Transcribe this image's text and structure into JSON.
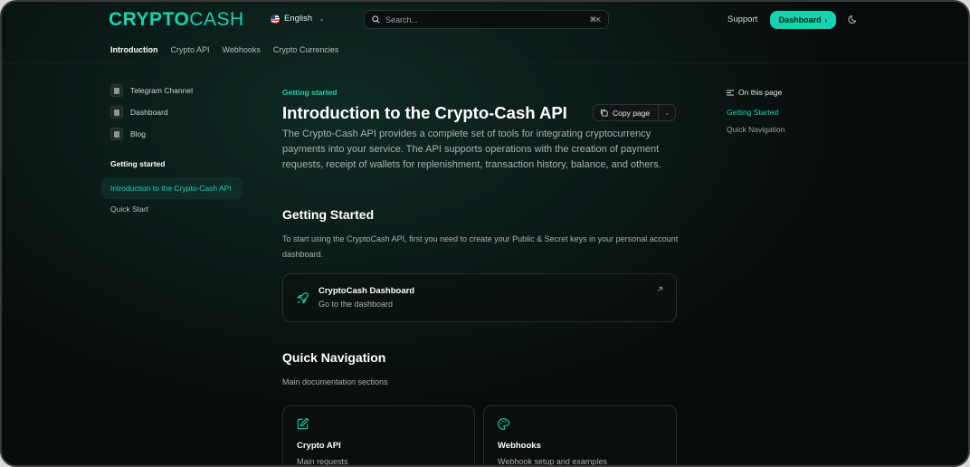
{
  "header": {
    "logo_bold": "CRYPTO",
    "logo_light": "CASH",
    "language": "English",
    "search_placeholder": "Search...",
    "search_shortcut": "⌘K",
    "support": "Support",
    "dashboard_button": "Dashboard",
    "brand_color": "#19d3b0"
  },
  "tabs": [
    {
      "label": "Introduction",
      "active": true
    },
    {
      "label": "Crypto API"
    },
    {
      "label": "Webhooks"
    },
    {
      "label": "Crypto Currencies"
    }
  ],
  "sidebar": {
    "links": [
      {
        "label": "Telegram Channel",
        "icon": "telegram-icon"
      },
      {
        "label": "Dashboard",
        "icon": "dashboard-icon"
      },
      {
        "label": "Blog",
        "icon": "blog-icon"
      }
    ],
    "group_title": "Getting started",
    "items": [
      {
        "label": "Introduction to the Crypto-Cash API",
        "active": true
      },
      {
        "label": "Quick Start"
      }
    ]
  },
  "main": {
    "breadcrumb": "Getting started",
    "title": "Introduction to the Crypto-Cash API",
    "copy_button": "Copy page",
    "intro": "The Crypto-Cash API provides a complete set of tools for integrating cryptocurrency payments into your service. The API supports operations with the creation of payment requests, receipt of wallets for replenishment, transaction history, balance, and others.",
    "getting_started": {
      "heading": "Getting Started",
      "text": "To start using the CryptoCash API, first you need to create your Public & Secret keys in your personal account dashboard.",
      "card": {
        "title": "CryptoCash Dashboard",
        "subtitle": "Go to the dashboard",
        "icon": "rocket-icon"
      }
    },
    "quick_navigation": {
      "heading": "Quick Navigation",
      "text": "Main documentation sections",
      "cards": [
        {
          "title": "Crypto API",
          "subtitle": "Main requests",
          "icon": "edit-icon"
        },
        {
          "title": "Webhooks",
          "subtitle": "Webhook setup and examples",
          "icon": "palette-icon"
        }
      ]
    }
  },
  "toc": {
    "heading": "On this page",
    "items": [
      {
        "label": "Getting Started",
        "active": true
      },
      {
        "label": "Quick Navigation"
      }
    ]
  }
}
